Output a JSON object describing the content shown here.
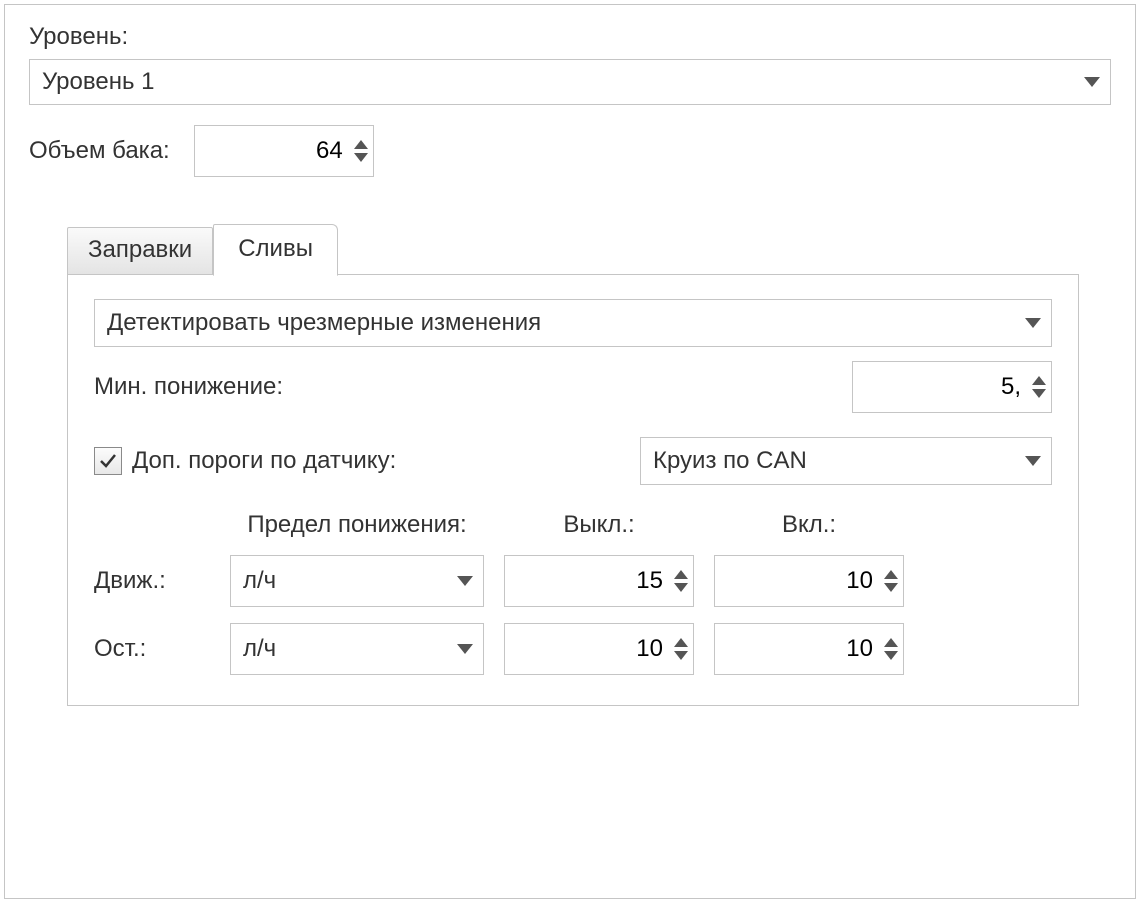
{
  "level": {
    "label": "Уровень:",
    "selected": "Уровень 1"
  },
  "tank": {
    "label": "Объем бака:",
    "value": "64"
  },
  "tabs": {
    "refuels": "Заправки",
    "drains": "Сливы"
  },
  "drains": {
    "detect_mode": "Детектировать чрезмерные изменения",
    "min_drop_label": "Мин. понижение:",
    "min_drop_value": "5,",
    "extra_thresholds_label": "Доп. пороги по датчику:",
    "extra_thresholds_checked": true,
    "sensor_selected": "Круиз по CAN",
    "headers": {
      "limit": "Предел понижения:",
      "off": "Выкл.:",
      "on": "Вкл.:"
    },
    "rows": {
      "moving": {
        "label": "Движ.:",
        "unit": "л/ч",
        "off": "15",
        "on": "10"
      },
      "stopped": {
        "label": "Ост.:",
        "unit": "л/ч",
        "off": "10",
        "on": "10"
      }
    }
  }
}
